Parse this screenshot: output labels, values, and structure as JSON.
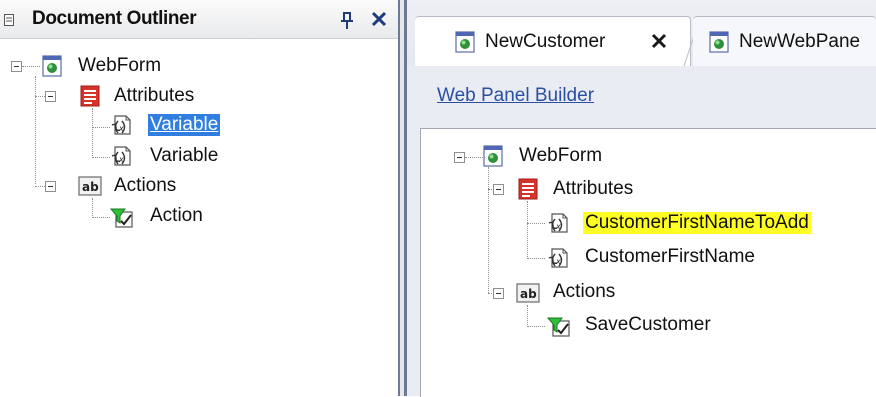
{
  "outliner": {
    "title": "Document Outliner",
    "tree": {
      "root": "WebForm",
      "attributes_group": "Attributes",
      "attributes": [
        "Variable",
        "Variable"
      ],
      "actions_group": "Actions",
      "actions": [
        "Action"
      ]
    }
  },
  "editor": {
    "tabs": [
      {
        "label": "NewCustomer",
        "active": true,
        "closable": true
      },
      {
        "label": "NewWebPane",
        "active": false,
        "closable": false
      }
    ],
    "builder_link": "Web Panel Builder",
    "tree": {
      "root": "WebForm",
      "attributes_group": "Attributes",
      "attributes": [
        "CustomerFirstNameToAdd",
        "CustomerFirstName"
      ],
      "actions_group": "Actions",
      "actions": [
        "SaveCustomer"
      ]
    }
  },
  "colors": {
    "selection": "#2f7ee0",
    "highlight": "#ffff24",
    "link": "#2b4fa3",
    "splitter": "#6d7a94"
  },
  "icons": {
    "webform": "webform-icon",
    "attributes": "attributes-icon",
    "variable": "variable-icon",
    "actions": "actions-icon",
    "action": "action-icon"
  }
}
